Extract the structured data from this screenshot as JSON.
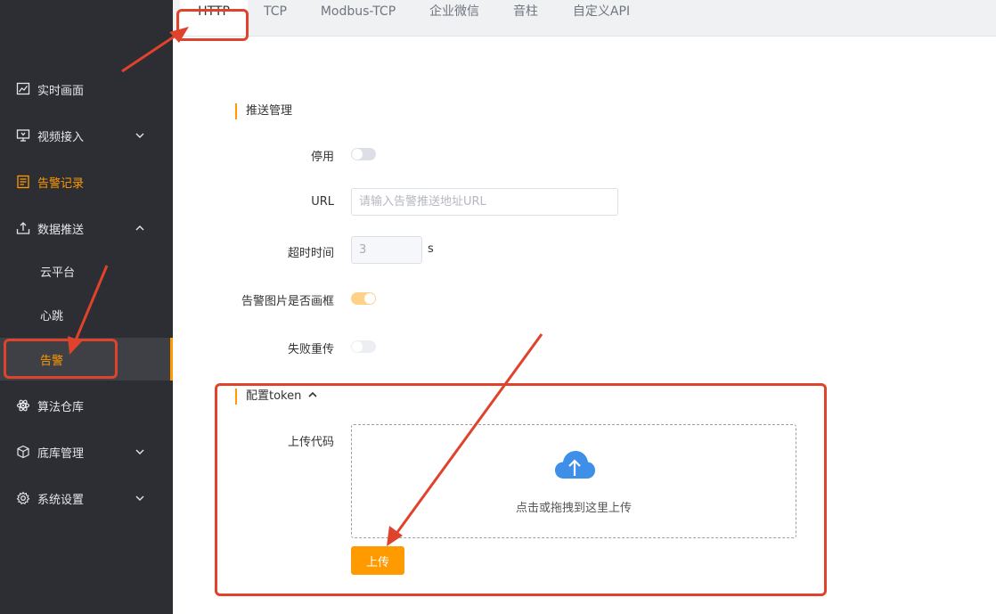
{
  "sidebar": {
    "items": [
      {
        "label": "实时画面",
        "icon": "line-chart-icon"
      },
      {
        "label": "视频接入",
        "icon": "monitor-icon",
        "chevron": "down"
      },
      {
        "label": "告警记录",
        "icon": "list-doc-icon",
        "active": true
      },
      {
        "label": "数据推送",
        "icon": "upload-tray-icon",
        "chevron": "up"
      }
    ],
    "sub_items": [
      {
        "label": "云平台"
      },
      {
        "label": "心跳"
      },
      {
        "label": "告警",
        "selected": true
      }
    ],
    "bottom_items": [
      {
        "label": "算法仓库",
        "icon": "atom-icon"
      },
      {
        "label": "底库管理",
        "icon": "cube-icon",
        "chevron": "down"
      },
      {
        "label": "系统设置",
        "icon": "gear-icon",
        "chevron": "down"
      }
    ]
  },
  "tabs": [
    {
      "label": "HTTP",
      "active": true
    },
    {
      "label": "TCP"
    },
    {
      "label": "Modbus-TCP"
    },
    {
      "label": "企业微信"
    },
    {
      "label": "音柱"
    },
    {
      "label": "自定义API"
    }
  ],
  "form": {
    "section_title": "推送管理",
    "disable_label": "停用",
    "disable_on": false,
    "url_label": "URL",
    "url_placeholder": "请输入告警推送地址URL",
    "url_value": "",
    "timeout_label": "超时时间",
    "timeout_value": "3",
    "timeout_unit": "s",
    "frame_label": "告警图片是否画框",
    "frame_on": true,
    "retry_label": "失败重传",
    "retry_on": false,
    "token_title": "配置token",
    "upload_code_label": "上传代码",
    "upload_hint": "点击或拖拽到这里上传",
    "upload_button": "上传"
  },
  "colors": {
    "accent": "#ff9a00",
    "sidebar_bg": "#2c2e33",
    "annotation_red": "#e0432c",
    "upload_icon": "#3d8fe8"
  }
}
